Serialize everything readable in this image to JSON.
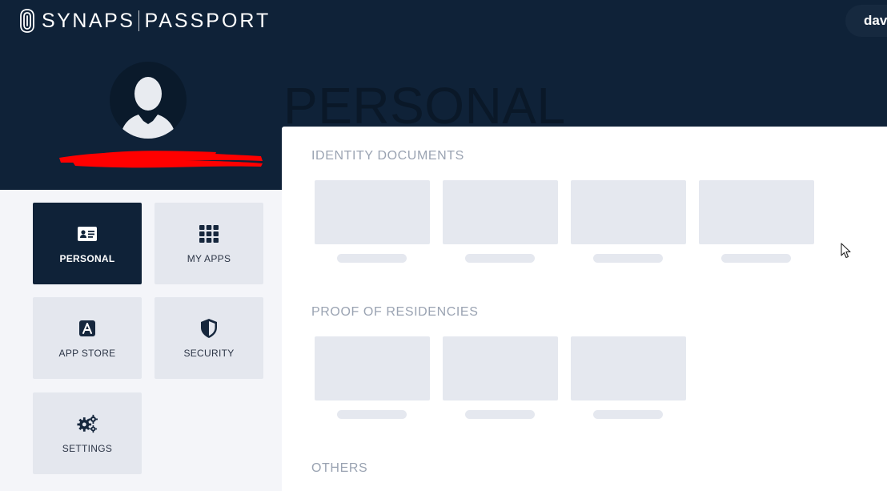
{
  "header": {
    "brand_primary": "SYNAPS",
    "brand_secondary": "PASSPORT",
    "user_name": "dav"
  },
  "page": {
    "title": "PERSONAL"
  },
  "nav": {
    "tiles": [
      {
        "label": "PERSONAL",
        "icon": "id-card-icon",
        "active": true
      },
      {
        "label": "MY APPS",
        "icon": "grid-icon",
        "active": false
      },
      {
        "label": "APP STORE",
        "icon": "app-store-icon",
        "active": false
      },
      {
        "label": "SECURITY",
        "icon": "shield-icon",
        "active": false
      },
      {
        "label": "SETTINGS",
        "icon": "gears-icon",
        "active": false
      }
    ]
  },
  "sections": [
    {
      "title": "IDENTITY DOCUMENTS",
      "placeholder_cards": 4
    },
    {
      "title": "PROOF OF RESIDENCIES",
      "placeholder_cards": 3
    },
    {
      "title": "OTHERS",
      "placeholder_cards": 0
    }
  ],
  "colors": {
    "header_bg": "#0f2238",
    "active_tile": "#0f2238",
    "tile_bg": "#e4e7ee",
    "placeholder": "#e5e8ef",
    "section_title": "#9aa3b2"
  }
}
